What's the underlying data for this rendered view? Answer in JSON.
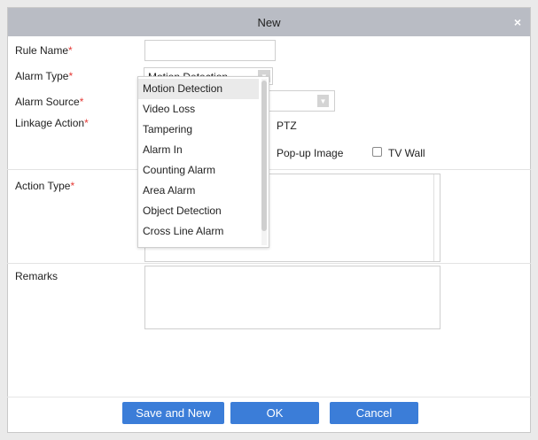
{
  "dialog": {
    "title": "New",
    "close_glyph": "×"
  },
  "form": {
    "rule_name": {
      "label": "Rule Name",
      "required": "*",
      "value": ""
    },
    "alarm_type": {
      "label": "Alarm Type",
      "required": "*",
      "selected": "Motion Detection"
    },
    "alarm_source": {
      "label": "Alarm Source",
      "required": "*",
      "selected": ""
    },
    "linkage_action": {
      "label": "Linkage Action",
      "required": "*",
      "option_ptz": "PTZ",
      "option_popup": "Pop-up Image",
      "option_tvwall": "TV Wall"
    },
    "action_type": {
      "label": "Action Type",
      "required": "*"
    },
    "remarks": {
      "label": "Remarks",
      "value": ""
    }
  },
  "dropdown": {
    "options": [
      "Motion Detection",
      "Video Loss",
      "Tampering",
      "Alarm In",
      "Counting Alarm",
      "Area Alarm",
      "Object Detection",
      "Cross Line Alarm"
    ]
  },
  "buttons": {
    "save_new": "Save and New",
    "ok": "OK",
    "cancel": "Cancel"
  },
  "colors": {
    "titlebar": "#b9bcc4",
    "primary_button": "#3b7dd8",
    "required": "#e53935"
  },
  "icons": {
    "close": "close-icon",
    "dropdown_arrow": "chevron-down-icon"
  }
}
